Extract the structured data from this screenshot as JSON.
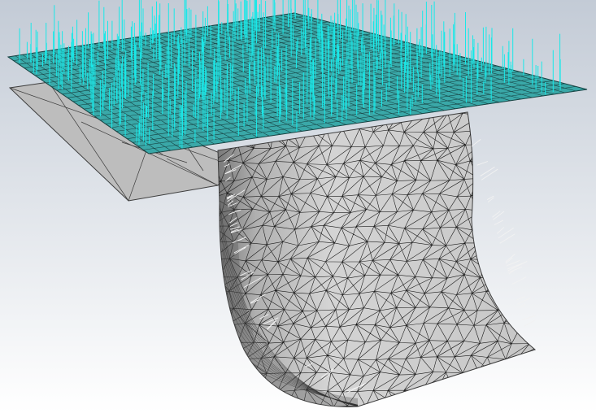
{
  "viewport": {
    "background_top": "#c3cbd6",
    "background_bottom": "#ffffff"
  },
  "colors": {
    "shelf_fill": "#bdbdbd",
    "shelf_edge": "#3c3c3c",
    "body_fill_light": "#d4d4d4",
    "body_fill_mid": "#b0b0b0",
    "body_fill_dark": "#7a7a7a",
    "mesh_line": "#1a1a1a",
    "top_plate_fill": "#3aa8a8",
    "top_plate_grid": "#163f3f",
    "force_arrow": "#19e8e8",
    "normal_arrow": "#f2f2f2"
  },
  "icons": {
    "model": "fea-mesh-model-icon"
  }
}
